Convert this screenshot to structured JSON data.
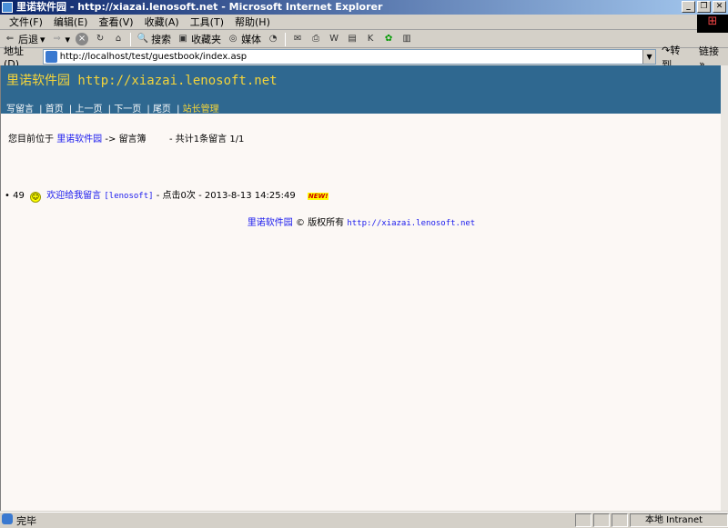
{
  "window": {
    "title": "里诺软件园 - http://xiazai.lenosoft.net - Microsoft Internet Explorer"
  },
  "menu": [
    "文件(F)",
    "编辑(E)",
    "查看(V)",
    "收藏(A)",
    "工具(T)",
    "帮助(H)"
  ],
  "toolbar": {
    "back": "后退",
    "search": "搜索",
    "favorites": "收藏夹",
    "media": "媒体"
  },
  "address": {
    "label": "地址(D)",
    "url": "http://localhost/test/guestbook/index.asp",
    "go": "转到",
    "links": "链接"
  },
  "site": {
    "title": "里诺软件园 http://xiazai.lenosoft.net",
    "nav": [
      "写留言",
      "首页",
      "上一页",
      "下一页",
      "尾页",
      "站长管理"
    ]
  },
  "breadcrumb": {
    "prefix": "您目前位于",
    "home": "里诺软件园",
    "arrow": "->",
    "current": "留言簿",
    "summary": "- 共计1条留言 1/1"
  },
  "entries": [
    {
      "id": "49",
      "title": "欢迎给我留言",
      "author": "[lenosoft]",
      "clicks": "- 点击0次 -",
      "datetime": "2013-8-13 14:25:49",
      "badge": "NEW!"
    }
  ],
  "footer": {
    "site": "里诺软件园",
    "copyright": "© 版权所有",
    "url": "http://xiazai.lenosoft.net"
  },
  "status": {
    "text": "完毕",
    "zone": "本地 Intranet"
  }
}
